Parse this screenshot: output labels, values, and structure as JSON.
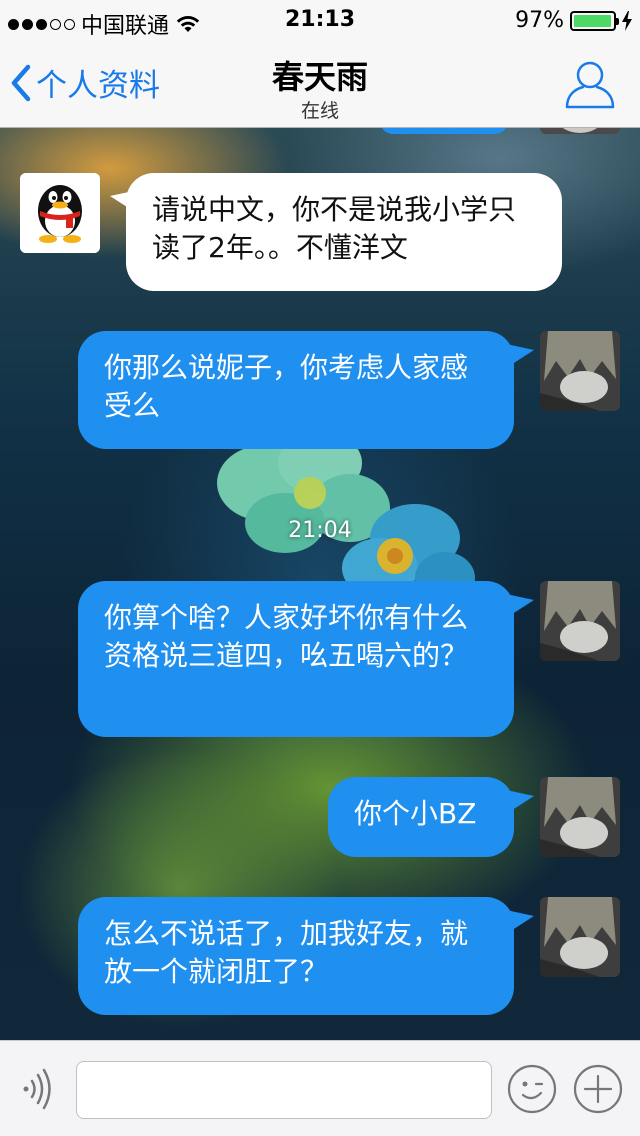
{
  "status_bar": {
    "signal_dots_filled": 3,
    "signal_dots_total": 5,
    "carrier": "中国联通",
    "wifi_icon": "wifi-icon",
    "time": "21:13",
    "battery_percent": "97%",
    "battery_level": 0.97,
    "battery_color": "#4cd964"
  },
  "nav": {
    "back_label": "个人资料",
    "title": "春天雨",
    "subtitle": "在线",
    "profile_icon": "person-icon",
    "accent_color": "#1a7ae8"
  },
  "chat": {
    "timestamp": "21:04",
    "messages": [
      {
        "sender": "them",
        "text": "请说中文，你不是说我小学只读了2年。。不懂洋文"
      },
      {
        "sender": "me",
        "text": "你那么说妮子，你考虑人家感受么"
      },
      {
        "sender": "me",
        "text": "你算个啥？人家好坏你有什么资格说三道四，吆五喝六的？"
      },
      {
        "sender": "me",
        "text": "你个小BZ"
      },
      {
        "sender": "me",
        "text": "怎么不说话了，加我好友，就放一个就闭肛了？"
      }
    ],
    "my_bubble_color": "#1f8ff0",
    "their_bubble_color": "#ffffff"
  },
  "input_bar": {
    "value": "",
    "voice_icon": "voice-icon",
    "emoji_icon": "emoji-icon",
    "plus_icon": "plus-icon"
  }
}
